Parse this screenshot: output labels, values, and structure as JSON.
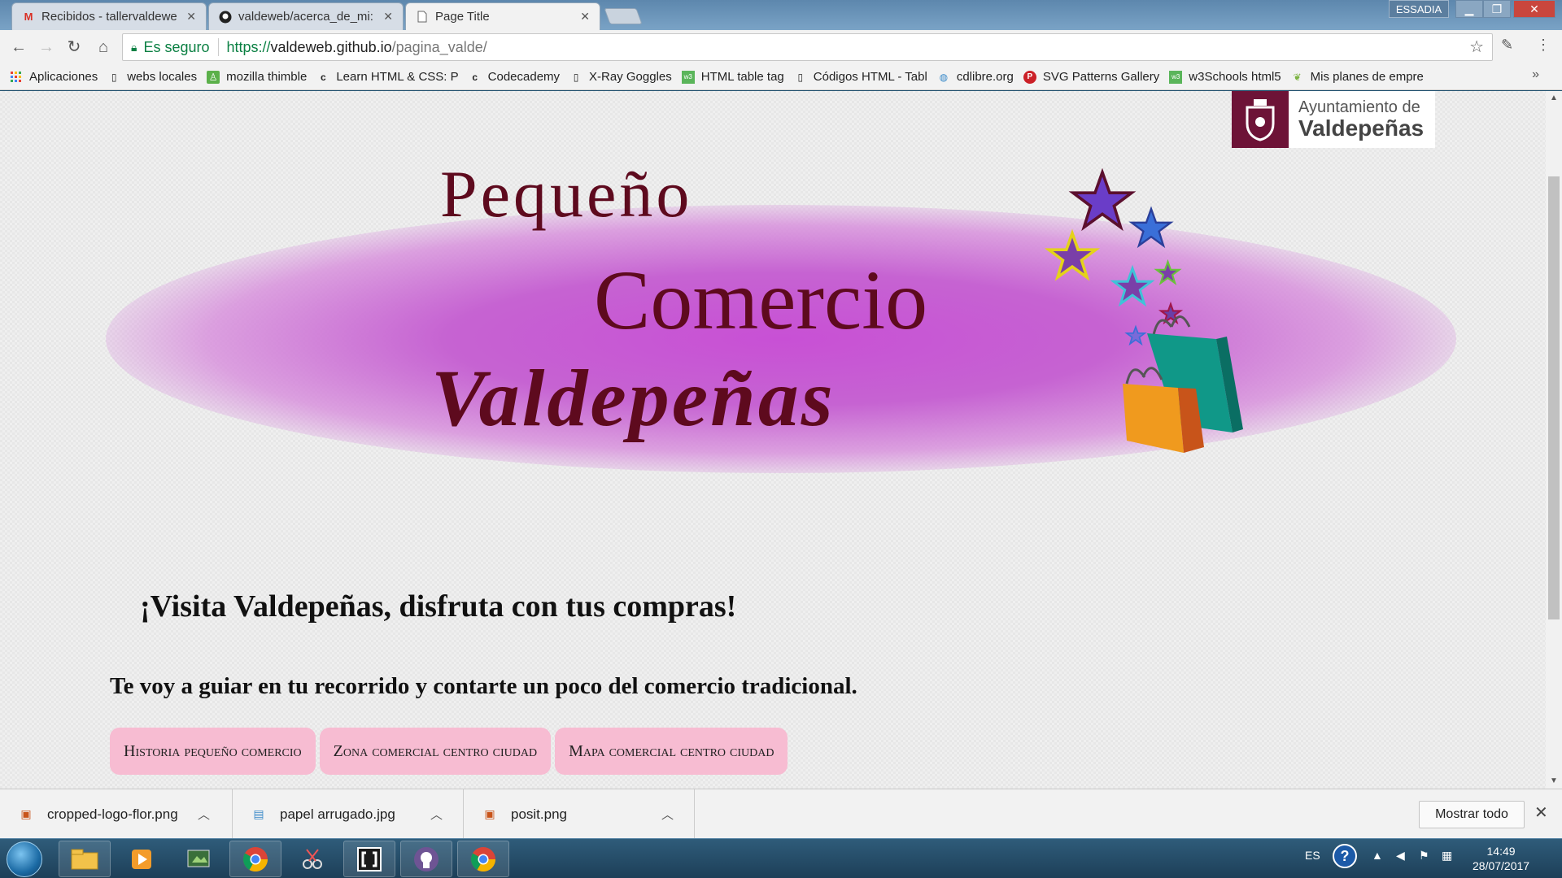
{
  "browser": {
    "tabs": [
      {
        "title": "Recibidos - tallervaldewe",
        "icon": "gmail-icon"
      },
      {
        "title": "valdeweb/acerca_de_mi:",
        "icon": "github-icon"
      },
      {
        "title": "Page Title",
        "icon": "page-icon"
      }
    ],
    "profile_label": "ESSADIA",
    "secure_label": "Es seguro",
    "url": {
      "scheme": "https://",
      "host": "valdeweb.github.io",
      "path": "/pagina_valde/"
    },
    "bookmarks": [
      {
        "label": "Aplicaciones",
        "icon": "apps-grid-icon"
      },
      {
        "label": "webs locales",
        "icon": "page-icon"
      },
      {
        "label": "mozilla thimble",
        "icon": "thimble-icon"
      },
      {
        "label": "Learn HTML & CSS: P",
        "icon": "codecademy-icon"
      },
      {
        "label": "Codecademy",
        "icon": "codecademy-icon"
      },
      {
        "label": "X-Ray Goggles",
        "icon": "page-icon"
      },
      {
        "label": "HTML table tag",
        "icon": "w3schools-icon"
      },
      {
        "label": "Códigos HTML - Tabl",
        "icon": "page-icon"
      },
      {
        "label": "cdlibre.org",
        "icon": "globe-icon"
      },
      {
        "label": "SVG Patterns Gallery",
        "icon": "pinterest-icon"
      },
      {
        "label": "w3Schools html5",
        "icon": "w3schools-icon"
      },
      {
        "label": "Mis planes de empre",
        "icon": "leaf-icon"
      }
    ],
    "more_label": "»"
  },
  "page": {
    "logo": {
      "line1": "Ayuntamiento de",
      "line2": "Valdepeñas"
    },
    "banner": {
      "word1": "Pequeño",
      "word2": "Comercio",
      "word3": "Valdepeñas"
    },
    "headline": "¡Visita Valdepeñas, disfruta con tus compras!",
    "subheadline": "Te voy a guiar en tu recorrido y contarte un poco del comercio tradicional.",
    "nav": [
      {
        "label": "Historia pequeño comercio"
      },
      {
        "label": "Zona comercial centro ciudad"
      },
      {
        "label": "Mapa comercial centro ciudad"
      }
    ]
  },
  "downloads": {
    "items": [
      {
        "name": "cropped-logo-flor.png",
        "icon": "png-file-icon"
      },
      {
        "name": "papel arrugado.jpg",
        "icon": "jpg-file-icon"
      },
      {
        "name": "posit.png",
        "icon": "png-file-icon"
      }
    ],
    "show_all_label": "Mostrar todo"
  },
  "taskbar": {
    "language": "ES",
    "time": "14:49",
    "date": "28/07/2017"
  },
  "colors": {
    "banner_text": "#5e0a1e",
    "banner_glow": "#c850d5",
    "nav_pill": "#f7bcd2",
    "logo_mark": "#6d1337",
    "secure_green": "#0b8043"
  }
}
